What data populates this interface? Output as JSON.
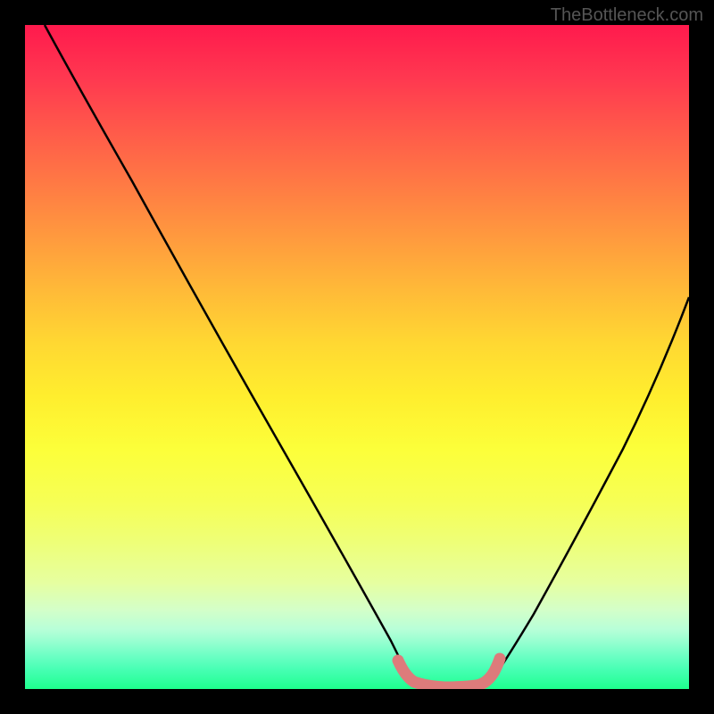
{
  "watermark": "TheBottleneck.com",
  "chart_data": {
    "type": "line",
    "title": "",
    "xlabel": "",
    "ylabel": "",
    "xlim": [
      0,
      100
    ],
    "ylim": [
      0,
      100
    ],
    "series": [
      {
        "name": "curve-left",
        "x": [
          3,
          10,
          20,
          30,
          40,
          50,
          55,
          58
        ],
        "y": [
          100,
          88,
          70,
          52,
          34,
          16,
          7,
          2
        ],
        "color": "#000000"
      },
      {
        "name": "curve-right",
        "x": [
          70,
          75,
          80,
          85,
          90,
          95,
          100
        ],
        "y": [
          2,
          9,
          18,
          28,
          39,
          50,
          61
        ],
        "color": "#000000"
      },
      {
        "name": "valley-highlight",
        "x": [
          56,
          58,
          60,
          62,
          64,
          66,
          68,
          70,
          71
        ],
        "y": [
          4,
          1.5,
          0.8,
          0.6,
          0.6,
          0.8,
          1.2,
          2,
          4
        ],
        "color": "#dd7b7b"
      }
    ],
    "background_gradient": {
      "top": "#ff1a4d",
      "mid": "#ffee2e",
      "bottom": "#1eff8c"
    }
  }
}
